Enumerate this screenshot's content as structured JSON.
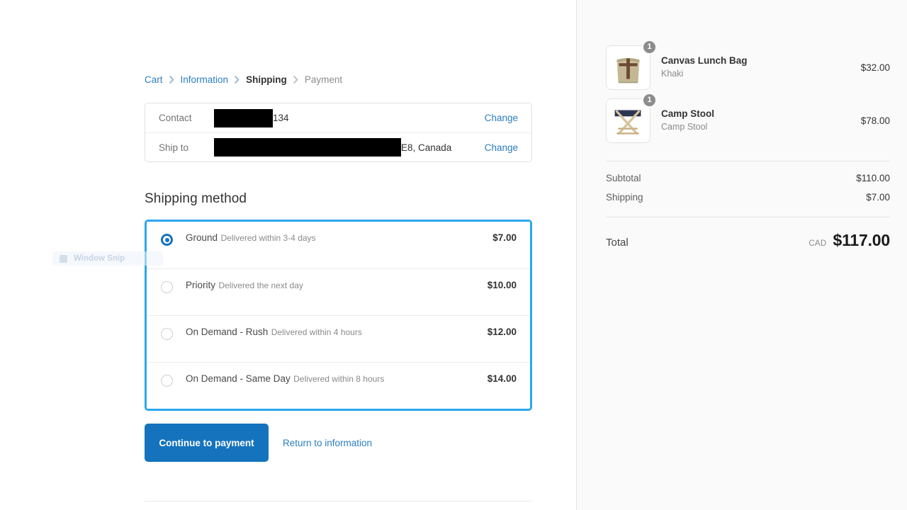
{
  "breadcrumb": {
    "items": [
      {
        "label": "Cart",
        "state": "link"
      },
      {
        "label": "Information",
        "state": "link"
      },
      {
        "label": "Shipping",
        "state": "current"
      },
      {
        "label": "Payment",
        "state": "muted"
      }
    ]
  },
  "review": {
    "rows": [
      {
        "label": "Contact",
        "value_redacted": true,
        "value_tail": "134",
        "change_label": "Change"
      },
      {
        "label": "Ship to",
        "value_redacted": true,
        "value_tail": "E8, Canada",
        "change_label": "Change"
      }
    ]
  },
  "shipping": {
    "section_title": "Shipping method",
    "options": [
      {
        "name": "Ground",
        "description": "Delivered within 3-4 days",
        "price": "$7.00",
        "selected": true
      },
      {
        "name": "Priority",
        "description": "Delivered the next day",
        "price": "$10.00",
        "selected": false
      },
      {
        "name": "On Demand - Rush",
        "description": "Delivered within 4 hours",
        "price": "$12.00",
        "selected": false
      },
      {
        "name": "On Demand - Same Day",
        "description": "Delivered within 8 hours",
        "price": "$14.00",
        "selected": false
      }
    ],
    "highlight_color": "#2BA7F0"
  },
  "actions": {
    "primary_label": "Continue to payment",
    "secondary_label": "Return to information",
    "primary_color": "#1573BD"
  },
  "overlay": {
    "ghost_label": "Window Snip",
    "ghost_icon": "scissors-icon"
  },
  "summary": {
    "items": [
      {
        "name": "Canvas Lunch Bag",
        "variant": "Khaki",
        "price": "$32.00",
        "qty": "1",
        "image": "canvas-lunch-bag-thumbnail"
      },
      {
        "name": "Camp Stool",
        "variant": "Camp Stool",
        "price": "$78.00",
        "qty": "1",
        "image": "camp-stool-thumbnail"
      }
    ],
    "subtotal_label": "Subtotal",
    "subtotal_value": "$110.00",
    "shipping_label": "Shipping",
    "shipping_value": "$7.00",
    "total_label": "Total",
    "total_currency": "CAD",
    "total_value": "$117.00"
  }
}
